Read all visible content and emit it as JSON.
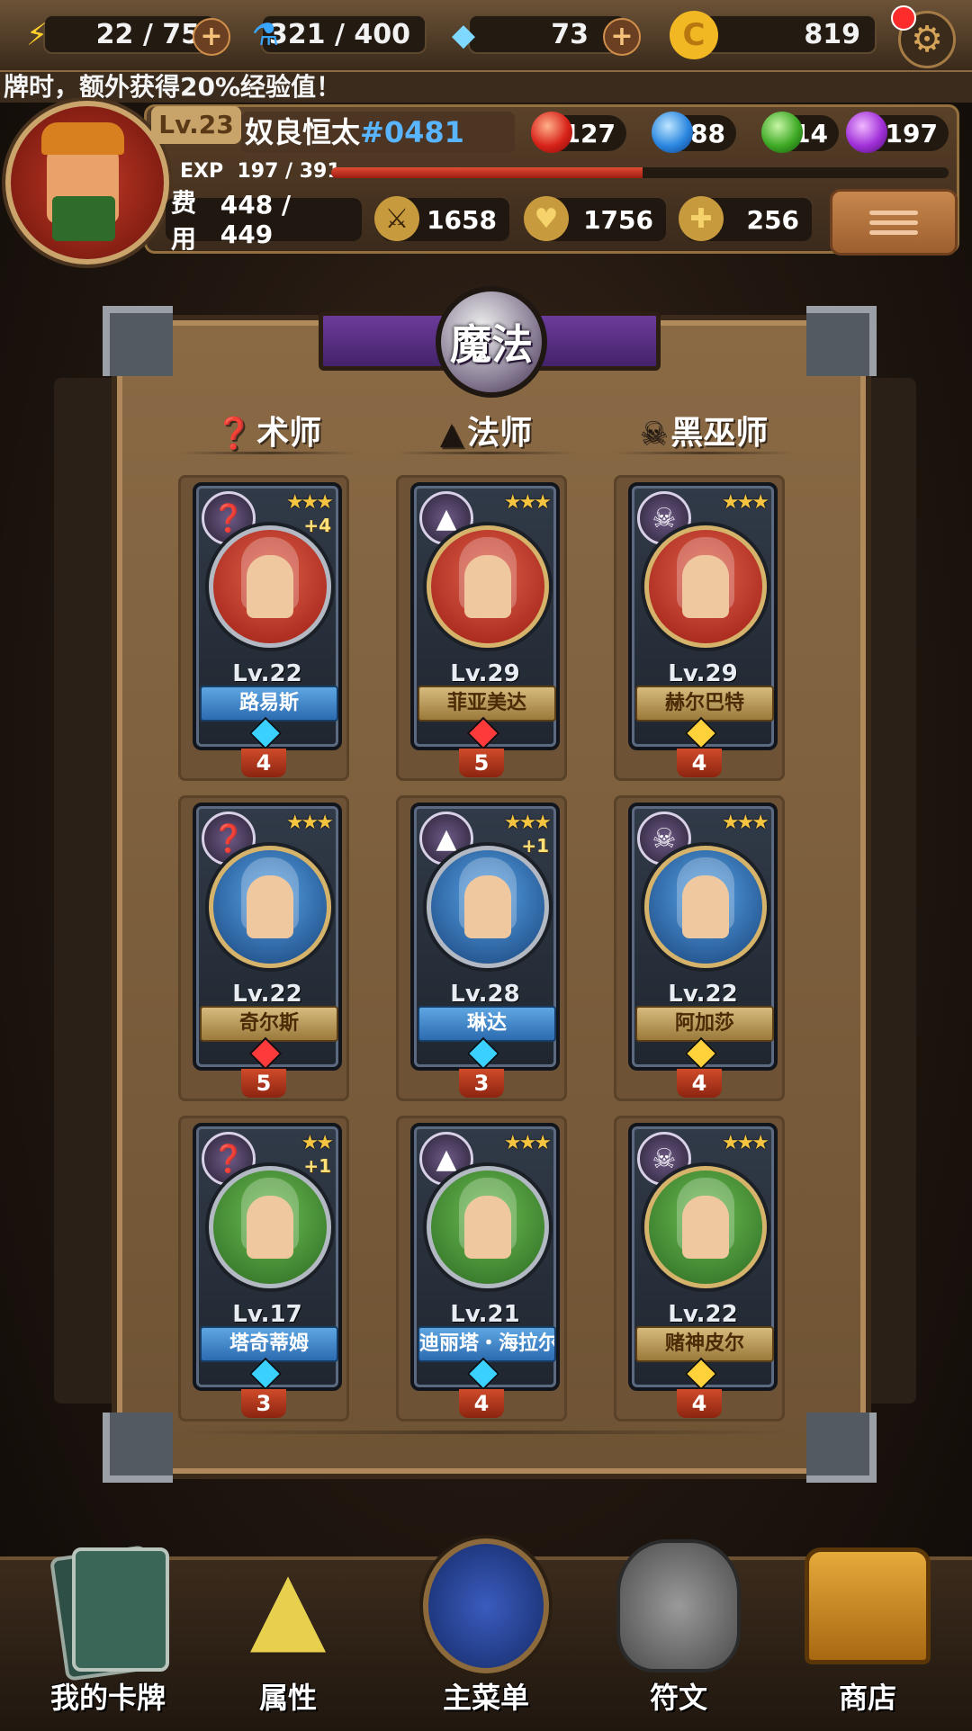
{
  "resources": {
    "energy": "22 / 75",
    "mana": "321 / 400",
    "gems": "73",
    "coins": "819"
  },
  "ticker": "牌时，额外获得20%经验值！",
  "player": {
    "level": "Lv.23",
    "name": "奴良恒太",
    "tag": "#0481",
    "exp_label": "EXP",
    "exp_value": "197 / 391",
    "exp_fraction": 0.504,
    "elements": {
      "fire": "127",
      "water": "88",
      "nature": "14",
      "dark": "197"
    },
    "cost_label": "费用",
    "cost": "448 / 449",
    "attack": "1658",
    "health": "1756",
    "heal": "256"
  },
  "board": {
    "title": "魔法",
    "columns": [
      "术师",
      "法师",
      "黑巫师"
    ]
  },
  "cards": [
    {
      "level": "Lv.22",
      "name": "路易斯",
      "stars": "★★★",
      "plus": "+4",
      "cost": "4",
      "plate": "blue",
      "bg": "red"
    },
    {
      "level": "Lv.29",
      "name": "菲亚美达",
      "stars": "★★★",
      "plus": "",
      "cost": "5",
      "plate": "gold",
      "bg": "red"
    },
    {
      "level": "Lv.29",
      "name": "赫尔巴特",
      "stars": "★★★",
      "plus": "",
      "cost": "4",
      "plate": "gold",
      "bg": "red"
    },
    {
      "level": "Lv.22",
      "name": "奇尔斯",
      "stars": "★★★",
      "plus": "",
      "cost": "5",
      "plate": "gold",
      "bg": "blue"
    },
    {
      "level": "Lv.28",
      "name": "琳达",
      "stars": "★★★",
      "plus": "+1",
      "cost": "3",
      "plate": "blue",
      "bg": "blue"
    },
    {
      "level": "Lv.22",
      "name": "阿加莎",
      "stars": "★★★",
      "plus": "",
      "cost": "4",
      "plate": "gold",
      "bg": "blue"
    },
    {
      "level": "Lv.17",
      "name": "塔奇蒂姆",
      "stars": "★★",
      "plus": "+1",
      "cost": "3",
      "plate": "blue",
      "bg": "green"
    },
    {
      "level": "Lv.21",
      "name": "迪丽塔・海拉尔",
      "stars": "★★★",
      "plus": "",
      "cost": "4",
      "plate": "blue",
      "bg": "green"
    },
    {
      "level": "Lv.22",
      "name": "赌神皮尔",
      "stars": "★★★",
      "plus": "",
      "cost": "4",
      "plate": "gold",
      "bg": "green"
    }
  ],
  "nav": [
    "我的卡牌",
    "属性",
    "主菜单",
    "符文",
    "商店"
  ]
}
